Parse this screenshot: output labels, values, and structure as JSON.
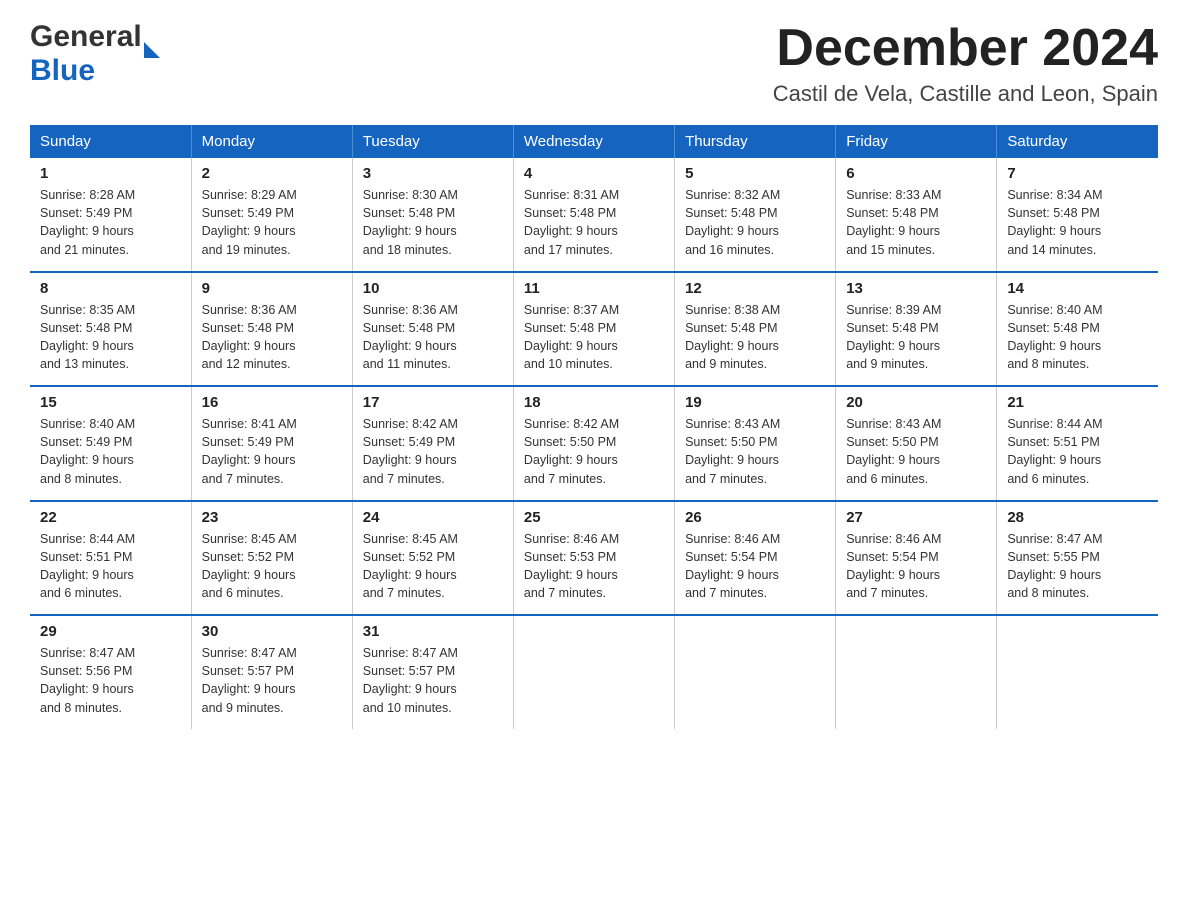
{
  "header": {
    "title": "December 2024",
    "subtitle": "Castil de Vela, Castille and Leon, Spain",
    "logo_general": "General",
    "logo_blue": "Blue"
  },
  "days_of_week": [
    "Sunday",
    "Monday",
    "Tuesday",
    "Wednesday",
    "Thursday",
    "Friday",
    "Saturday"
  ],
  "weeks": [
    [
      {
        "day": "1",
        "sunrise": "8:28 AM",
        "sunset": "5:49 PM",
        "daylight": "9 hours and 21 minutes."
      },
      {
        "day": "2",
        "sunrise": "8:29 AM",
        "sunset": "5:49 PM",
        "daylight": "9 hours and 19 minutes."
      },
      {
        "day": "3",
        "sunrise": "8:30 AM",
        "sunset": "5:48 PM",
        "daylight": "9 hours and 18 minutes."
      },
      {
        "day": "4",
        "sunrise": "8:31 AM",
        "sunset": "5:48 PM",
        "daylight": "9 hours and 17 minutes."
      },
      {
        "day": "5",
        "sunrise": "8:32 AM",
        "sunset": "5:48 PM",
        "daylight": "9 hours and 16 minutes."
      },
      {
        "day": "6",
        "sunrise": "8:33 AM",
        "sunset": "5:48 PM",
        "daylight": "9 hours and 15 minutes."
      },
      {
        "day": "7",
        "sunrise": "8:34 AM",
        "sunset": "5:48 PM",
        "daylight": "9 hours and 14 minutes."
      }
    ],
    [
      {
        "day": "8",
        "sunrise": "8:35 AM",
        "sunset": "5:48 PM",
        "daylight": "9 hours and 13 minutes."
      },
      {
        "day": "9",
        "sunrise": "8:36 AM",
        "sunset": "5:48 PM",
        "daylight": "9 hours and 12 minutes."
      },
      {
        "day": "10",
        "sunrise": "8:36 AM",
        "sunset": "5:48 PM",
        "daylight": "9 hours and 11 minutes."
      },
      {
        "day": "11",
        "sunrise": "8:37 AM",
        "sunset": "5:48 PM",
        "daylight": "9 hours and 10 minutes."
      },
      {
        "day": "12",
        "sunrise": "8:38 AM",
        "sunset": "5:48 PM",
        "daylight": "9 hours and 9 minutes."
      },
      {
        "day": "13",
        "sunrise": "8:39 AM",
        "sunset": "5:48 PM",
        "daylight": "9 hours and 9 minutes."
      },
      {
        "day": "14",
        "sunrise": "8:40 AM",
        "sunset": "5:48 PM",
        "daylight": "9 hours and 8 minutes."
      }
    ],
    [
      {
        "day": "15",
        "sunrise": "8:40 AM",
        "sunset": "5:49 PM",
        "daylight": "9 hours and 8 minutes."
      },
      {
        "day": "16",
        "sunrise": "8:41 AM",
        "sunset": "5:49 PM",
        "daylight": "9 hours and 7 minutes."
      },
      {
        "day": "17",
        "sunrise": "8:42 AM",
        "sunset": "5:49 PM",
        "daylight": "9 hours and 7 minutes."
      },
      {
        "day": "18",
        "sunrise": "8:42 AM",
        "sunset": "5:50 PM",
        "daylight": "9 hours and 7 minutes."
      },
      {
        "day": "19",
        "sunrise": "8:43 AM",
        "sunset": "5:50 PM",
        "daylight": "9 hours and 7 minutes."
      },
      {
        "day": "20",
        "sunrise": "8:43 AM",
        "sunset": "5:50 PM",
        "daylight": "9 hours and 6 minutes."
      },
      {
        "day": "21",
        "sunrise": "8:44 AM",
        "sunset": "5:51 PM",
        "daylight": "9 hours and 6 minutes."
      }
    ],
    [
      {
        "day": "22",
        "sunrise": "8:44 AM",
        "sunset": "5:51 PM",
        "daylight": "9 hours and 6 minutes."
      },
      {
        "day": "23",
        "sunrise": "8:45 AM",
        "sunset": "5:52 PM",
        "daylight": "9 hours and 6 minutes."
      },
      {
        "day": "24",
        "sunrise": "8:45 AM",
        "sunset": "5:52 PM",
        "daylight": "9 hours and 7 minutes."
      },
      {
        "day": "25",
        "sunrise": "8:46 AM",
        "sunset": "5:53 PM",
        "daylight": "9 hours and 7 minutes."
      },
      {
        "day": "26",
        "sunrise": "8:46 AM",
        "sunset": "5:54 PM",
        "daylight": "9 hours and 7 minutes."
      },
      {
        "day": "27",
        "sunrise": "8:46 AM",
        "sunset": "5:54 PM",
        "daylight": "9 hours and 7 minutes."
      },
      {
        "day": "28",
        "sunrise": "8:47 AM",
        "sunset": "5:55 PM",
        "daylight": "9 hours and 8 minutes."
      }
    ],
    [
      {
        "day": "29",
        "sunrise": "8:47 AM",
        "sunset": "5:56 PM",
        "daylight": "9 hours and 8 minutes."
      },
      {
        "day": "30",
        "sunrise": "8:47 AM",
        "sunset": "5:57 PM",
        "daylight": "9 hours and 9 minutes."
      },
      {
        "day": "31",
        "sunrise": "8:47 AM",
        "sunset": "5:57 PM",
        "daylight": "9 hours and 10 minutes."
      },
      null,
      null,
      null,
      null
    ]
  ],
  "labels": {
    "sunrise": "Sunrise:",
    "sunset": "Sunset:",
    "daylight": "Daylight:"
  }
}
